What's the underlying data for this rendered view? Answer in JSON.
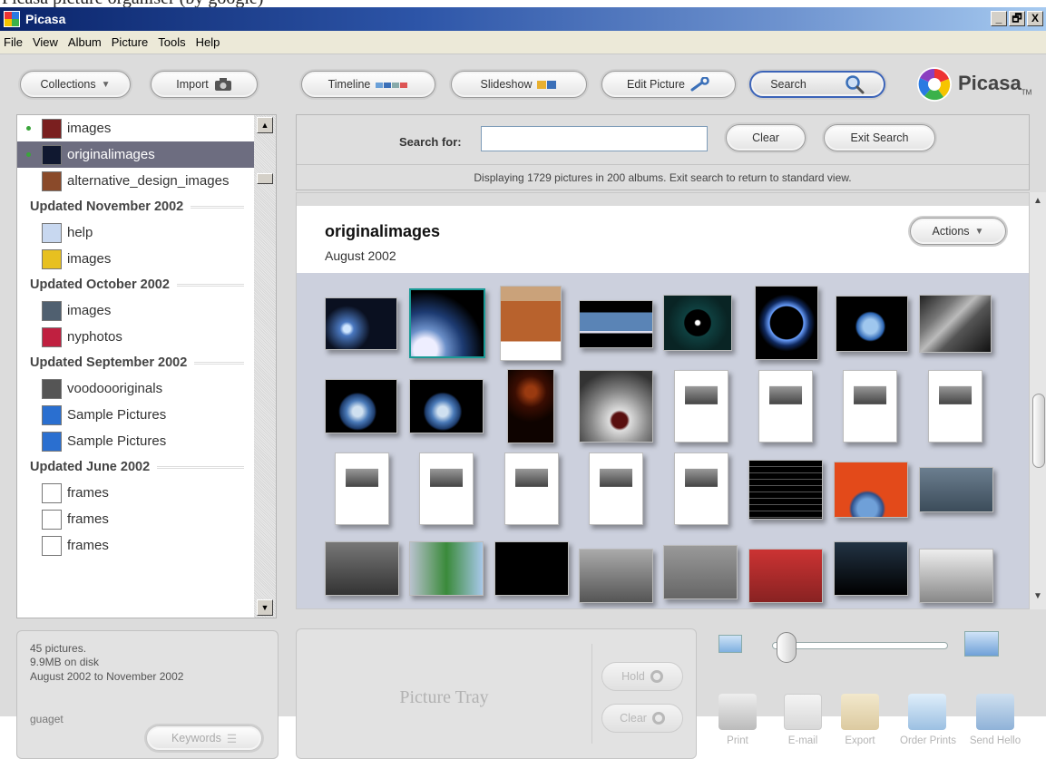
{
  "ghost_caption": "Picasa picture organiser (by google)",
  "window": {
    "title": "Picasa",
    "buttons": [
      "_",
      "🗗",
      "X"
    ]
  },
  "menu": [
    "File",
    "View",
    "Album",
    "Picture",
    "Tools",
    "Help"
  ],
  "toolbar": {
    "collections": "Collections",
    "import": "Import",
    "timeline": "Timeline",
    "slideshow": "Slideshow",
    "edit_picture": "Edit Picture",
    "search": "Search",
    "logo": "Picasa",
    "logo_tm": "TM"
  },
  "albums": [
    {
      "type": "album",
      "label": "images",
      "dot": true,
      "selected": false
    },
    {
      "type": "album",
      "label": "originalimages",
      "dot": true,
      "selected": true
    },
    {
      "type": "album",
      "label": "alternative_design_images"
    },
    {
      "type": "group",
      "label": "Updated November 2002"
    },
    {
      "type": "album",
      "label": "help"
    },
    {
      "type": "album",
      "label": "images"
    },
    {
      "type": "group",
      "label": "Updated October 2002"
    },
    {
      "type": "album",
      "label": "images"
    },
    {
      "type": "album",
      "label": "nyphotos"
    },
    {
      "type": "group",
      "label": "Updated September 2002"
    },
    {
      "type": "album",
      "label": "voodoooriginals"
    },
    {
      "type": "album",
      "label": "Sample Pictures"
    },
    {
      "type": "album",
      "label": "Sample Pictures"
    },
    {
      "type": "group",
      "label": "Updated June 2002"
    },
    {
      "type": "album",
      "label": "frames"
    },
    {
      "type": "album",
      "label": "frames"
    },
    {
      "type": "album",
      "label": "frames"
    }
  ],
  "info": {
    "count": "45 pictures.",
    "size": "9.9MB on disk",
    "range": "August 2002 to November 2002",
    "keyword_text": "guaget",
    "keywords_button": "Keywords"
  },
  "search_panel": {
    "label": "Search for:",
    "value": "",
    "clear": "Clear",
    "exit": "Exit Search",
    "status": "Displaying 1729 pictures in 200 albums. Exit search to return to standard view."
  },
  "album_view": {
    "title": "originalimages",
    "date": "August 2002",
    "actions": "Actions"
  },
  "tray": {
    "title": "Picture Tray",
    "hold": "Hold",
    "clear": "Clear"
  },
  "actions": [
    "Print",
    "E-mail",
    "Export",
    "Order Prints",
    "Send Hello"
  ],
  "zoom_level": 0.08,
  "colors": {
    "selection": "#6d6d80",
    "search_active": "#3b63b8",
    "grid_bg": "#ccd0dd",
    "title_gradient_start": "#0a246a"
  }
}
